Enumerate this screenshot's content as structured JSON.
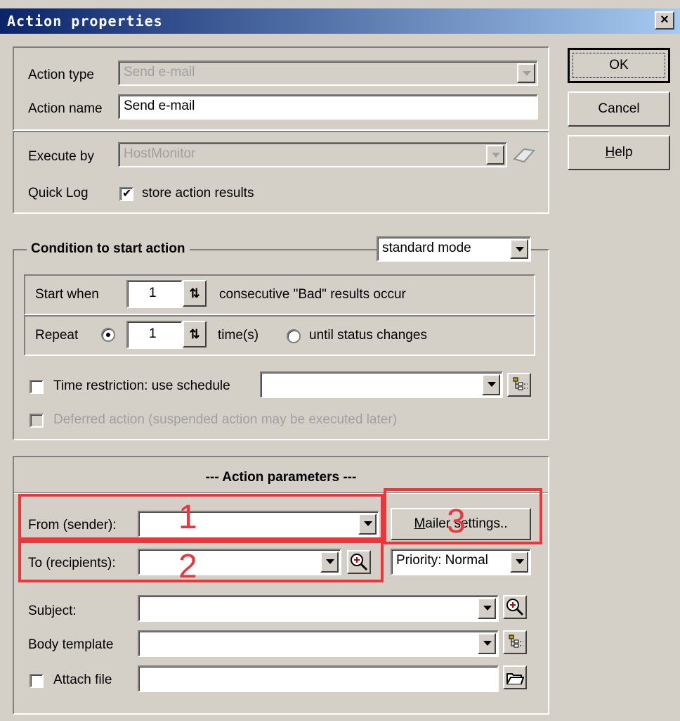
{
  "window": {
    "title": "Action properties",
    "close_label": "×"
  },
  "buttons": {
    "ok": "OK",
    "cancel": "Cancel",
    "help_prefix": "",
    "help_u": "H",
    "help_rest": "elp"
  },
  "action": {
    "type_label": "Action type",
    "type_value": "Send e-mail",
    "name_label": "Action name",
    "name_value": "Send e-mail"
  },
  "execute": {
    "by_label": "Execute by",
    "by_value": "HostMonitor",
    "quicklog_label": "Quick Log",
    "quicklog_check": "store action results",
    "quicklog_checked": true
  },
  "condition": {
    "caption": "Condition to start action",
    "mode": "standard mode",
    "start_when_label": "Start when",
    "start_when_value": "1",
    "start_when_suffix": "consecutive \"Bad\" results occur",
    "repeat_label": "Repeat",
    "repeat_value": "1",
    "repeat_suffix": "time(s)",
    "until_label": "until status changes",
    "time_restriction_label": "Time restriction: use schedule",
    "deferred_label": "Deferred action (suspended action may be executed later)"
  },
  "params": {
    "caption": "---  Action parameters  ---",
    "from_label": "From (sender):",
    "from_value": "",
    "to_label": "To (recipients):",
    "to_value": "",
    "mailer_pre": "Mailer",
    "mailer_mid": "s",
    "mailer_post": "ettings..",
    "mailer_u": "M",
    "mailer_rest": "ailer settings..",
    "priority": "Priority: Normal",
    "subject_label": "Subject:",
    "body_label": "Body template",
    "attach_label": "Attach file"
  },
  "annotations": [
    "1",
    "2",
    "3"
  ],
  "colors": {
    "annotation": "#e8383d",
    "titlebar": "#0a246a",
    "face": "#d4d0c8"
  }
}
